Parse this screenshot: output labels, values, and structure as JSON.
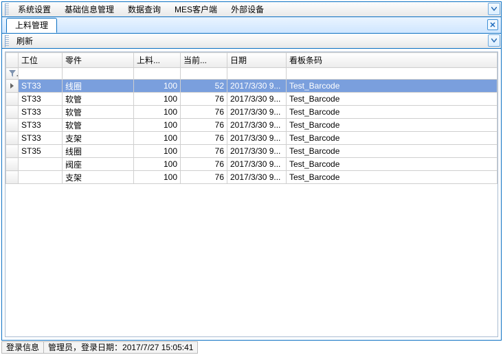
{
  "menubar": {
    "items": [
      "系统设置",
      "基础信息管理",
      "数据查询",
      "MES客户端",
      "外部设备"
    ]
  },
  "tabbar": {
    "active_tab": "上料管理"
  },
  "toolbar": {
    "refresh": "刷新"
  },
  "grid": {
    "columns": [
      "工位",
      "零件",
      "上料...",
      "当前...",
      "日期",
      "看板条码"
    ],
    "filter_tooltip": "筛选",
    "rows": [
      {
        "sel": true,
        "station": "ST33",
        "part": "线圈",
        "qty": "100",
        "cur": "52",
        "date": "2017/3/30 9...",
        "barcode": "Test_Barcode"
      },
      {
        "sel": false,
        "station": "ST33",
        "part": "软管",
        "qty": "100",
        "cur": "76",
        "date": "2017/3/30 9...",
        "barcode": "Test_Barcode"
      },
      {
        "sel": false,
        "station": "ST33",
        "part": "软管",
        "qty": "100",
        "cur": "76",
        "date": "2017/3/30 9...",
        "barcode": "Test_Barcode"
      },
      {
        "sel": false,
        "station": "ST33",
        "part": "软管",
        "qty": "100",
        "cur": "76",
        "date": "2017/3/30 9...",
        "barcode": "Test_Barcode"
      },
      {
        "sel": false,
        "station": "ST33",
        "part": "支架",
        "qty": "100",
        "cur": "76",
        "date": "2017/3/30 9...",
        "barcode": "Test_Barcode"
      },
      {
        "sel": false,
        "station": "ST35",
        "part": "线圈",
        "qty": "100",
        "cur": "76",
        "date": "2017/3/30 9...",
        "barcode": "Test_Barcode"
      },
      {
        "sel": false,
        "station": "",
        "part": "阀座",
        "qty": "100",
        "cur": "76",
        "date": "2017/3/30 9...",
        "barcode": "Test_Barcode"
      },
      {
        "sel": false,
        "station": "",
        "part": "支架",
        "qty": "100",
        "cur": "76",
        "date": "2017/3/30 9...",
        "barcode": "Test_Barcode"
      }
    ]
  },
  "statusbar": {
    "label": "登录信息",
    "text": "管理员，登录日期：2017/7/27 15:05:41"
  }
}
